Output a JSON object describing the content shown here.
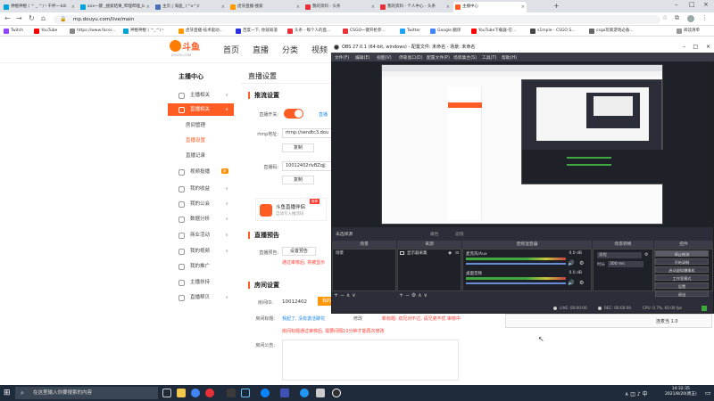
{
  "tabs": [
    {
      "title": "神棍神棍 ( ^ _ ^)丶干杯~-bili",
      "color": "#00a1d6"
    },
    {
      "title": "xxx一键 _搜索结果_哔哩哔哩_b",
      "color": "#00a1d6"
    },
    {
      "title": "主页 | 海盗_ (^o^)/",
      "color": "#4b6fb3"
    },
    {
      "title": "虎牙直播-搜索",
      "color": "#ff9900"
    },
    {
      "title": "我的资料 - 头条",
      "color": "#e8303a"
    },
    {
      "title": "我的资料 - 个人中心 - 头条",
      "color": "#e8303a"
    },
    {
      "title": "主播中心",
      "color": "#ff5d23",
      "active": true
    }
  ],
  "address": {
    "url": "mp.douyu.com/live/main"
  },
  "bookmarks": [
    {
      "label": "Twitch",
      "color": "#9146ff"
    },
    {
      "label": "YouTube",
      "color": "#ff0000"
    },
    {
      "label": "https://www.facei...",
      "color": "#888888"
    },
    {
      "label": "神棍神棍 ( ^_^)丶",
      "color": "#00a1d6"
    },
    {
      "label": "虎牙直播-技术驱动...",
      "color": "#ff9900"
    },
    {
      "label": "百度一下, 你就知道",
      "color": "#2932e1"
    },
    {
      "label": "头条 - 每个人的直...",
      "color": "#e8303a"
    },
    {
      "label": "CSGO一键开枪参...",
      "color": "#e8303a"
    },
    {
      "label": "Twitter",
      "color": "#1da1f2"
    },
    {
      "label": "Google 翻译",
      "color": "#4285f4"
    },
    {
      "label": "YouTube下载器-在...",
      "color": "#ff0000"
    },
    {
      "label": "s1mple - CSGO S...",
      "color": "#444444"
    },
    {
      "label": "csgo玩家游戏必备...",
      "color": "#666666"
    }
  ],
  "bookmarks_other": "阅读清单",
  "douyu": {
    "logo_text": "斗鱼",
    "logo_sub": "DOUYU.COM",
    "nav": [
      "首页",
      "直播",
      "分类",
      "视频"
    ]
  },
  "sidebar": {
    "title": "主播中心",
    "items": [
      {
        "label": "主播相关",
        "type": "group"
      },
      {
        "label": "直播相关",
        "type": "group",
        "active": true
      },
      {
        "label": "房间管理",
        "type": "sub"
      },
      {
        "label": "直播设置",
        "type": "sub",
        "selected": true
      },
      {
        "label": "直播记录",
        "type": "sub"
      },
      {
        "label": "视频投播",
        "type": "group",
        "badge": "新"
      },
      {
        "label": "我的收益",
        "type": "group"
      },
      {
        "label": "我的公会",
        "type": "group"
      },
      {
        "label": "数据分析",
        "type": "group"
      },
      {
        "label": "商业活动",
        "type": "group"
      },
      {
        "label": "我的视频",
        "type": "group"
      },
      {
        "label": "我的推广",
        "type": "group"
      },
      {
        "label": "主播扶持",
        "type": "group"
      },
      {
        "label": "直播帮贝",
        "type": "group"
      }
    ]
  },
  "content": {
    "page_title": "直播设置",
    "push": {
      "title": "推流设置",
      "switch_label": "直播开关:",
      "link": "直播",
      "rtmp_label": "rtmp地址:",
      "rtmp_value": "rtmp://sendtc3.dou",
      "copy1": "复制",
      "code_label": "直播码:",
      "code_value": "10012402rlvBZqjj",
      "copy2": "复制",
      "promo_title": "斗鱼直播伴侣",
      "promo_sub": "自动写入推流码",
      "promo_badge": "推荐"
    },
    "notice": {
      "title": "直播预告",
      "label": "直播预告:",
      "btn": "设置预告",
      "warn": "通过审核后, 将被显示"
    },
    "room": {
      "title": "房间设置",
      "id_label": "房间ID:",
      "id_value": "10012402",
      "id_btn": "我的",
      "title_label": "房间标题:",
      "title_value": "我起了, 没有激活聊花",
      "title_edit": "修改",
      "title_note": "新标题: 双兄对不过, 请兄弟不优 审核中",
      "title_warn": "房间标题通过审核后, 需要间隔10分钟才能再次修改",
      "announce_label": "房间公告:"
    }
  },
  "obs": {
    "title": "OBS 27.0.1 (64-bit, windows) - 配置文件: 未命名 - 场景: 未命名",
    "menu": [
      "文件(F)",
      "编辑(E)",
      "视图(V)",
      "停靠窗口(D)",
      "配置文件(P)",
      "场景集合(S)",
      "工具(T)",
      "帮助(H)"
    ],
    "no_source": "未选择源",
    "props": "属性",
    "filters": "滤镜",
    "docks": {
      "scenes": {
        "title": "场景",
        "items": [
          "场景"
        ]
      },
      "sources": {
        "title": "来源",
        "items": [
          "显示器采集"
        ]
      },
      "mixer": {
        "title": "音频混音器",
        "tracks": [
          {
            "name": "麦克风/Aux",
            "db": "0.0 dB"
          },
          {
            "name": "桌面音频",
            "db": "0.0 dB"
          }
        ]
      },
      "transitions": {
        "title": "场景转换",
        "type": "淡化",
        "duration_label": "时长",
        "duration": "300 ms"
      },
      "controls": {
        "title": "控件",
        "buttons": [
          "停止推流",
          "开始录制",
          "启动虚拟摄像机",
          "工作室模式",
          "设置",
          "退出"
        ]
      }
    },
    "status": {
      "live": "LIVE: 00:00:00",
      "rec": "REC: 00:00:00",
      "cpu": "CPU: 0.7%, 60.00 fps"
    }
  },
  "right_panel": {
    "label": "连麦当 1.0"
  },
  "taskbar": {
    "search": "在这里输入你要搜索的内容",
    "time": "14:32:35",
    "date": "2021/8/20(周五)"
  }
}
